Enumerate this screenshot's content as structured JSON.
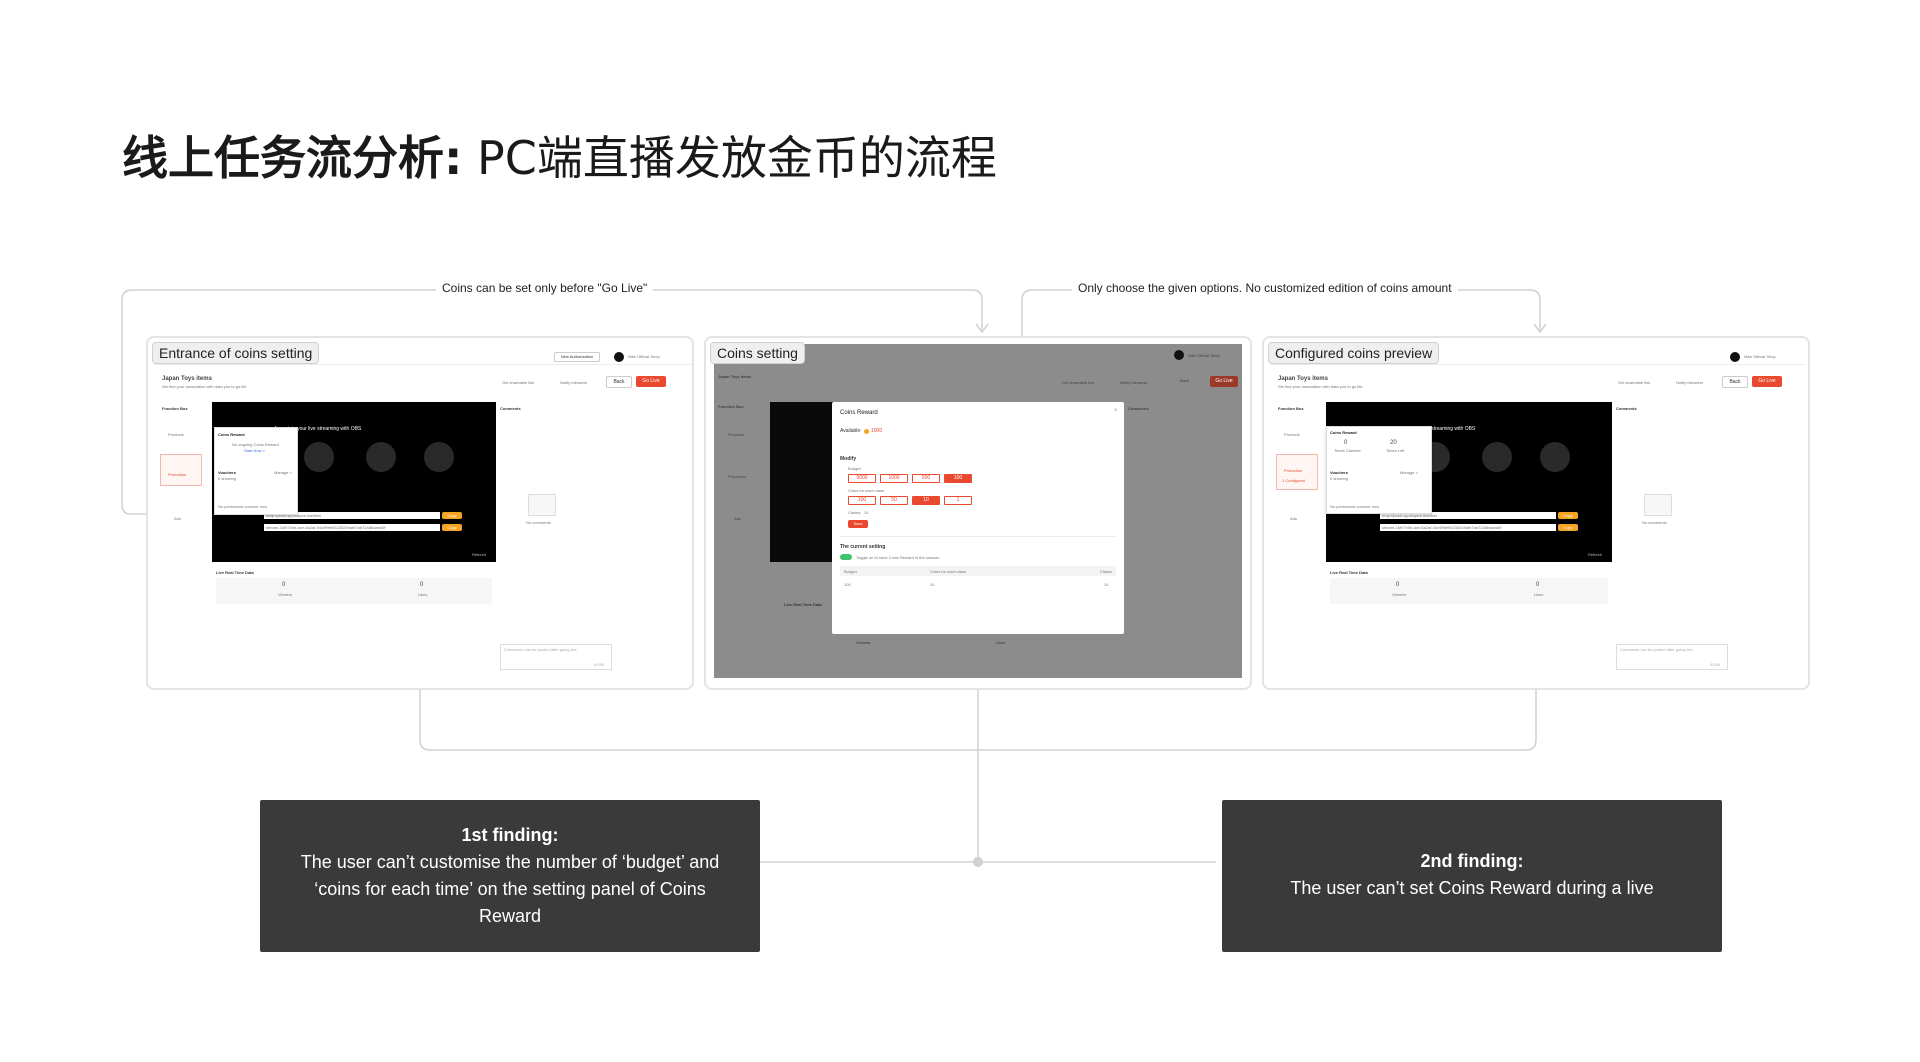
{
  "page": {
    "title_bold": "线上任务流分析:",
    "title_rest": " PC端直播发放金币的流程"
  },
  "annotations": {
    "left": "Coins can be set only before \"Go Live\"",
    "right": "Only choose the given options. No customized edition of coins amount"
  },
  "panels": [
    {
      "tag": "Entrance of coins setting"
    },
    {
      "tag": "Coins setting"
    },
    {
      "tag": "Configured coins preview"
    }
  ],
  "app": {
    "page_title": "Japan Toys items",
    "page_subtitle": "We find your association with data you to go life",
    "get_shareable_link": "Get shareable link",
    "notify_followers": "Notify followers",
    "back": "Back",
    "go_live": "Go Live",
    "new_authorization": "New Authorization",
    "shop_name": "Nike Official Shop",
    "function_box": "Function Box",
    "products": "Products",
    "promotion": "Promotion",
    "ads": "Ads",
    "comments": "Comments",
    "no_comments": "No comments",
    "obs_heading": "Associate your live streaming with OBS",
    "steps": [
      "1.Fill in the URL and Key in the OBS",
      "2.Click \"start streaming\" in the OBS",
      "3.Refresh to preview live stream"
    ],
    "stream_url": "rtmp://push-sg.shopee.live/live/",
    "stream_key": "stream-16f07e5e-ace-6a2af-04c9f9fe93235269afb7ab7248bdaea0f",
    "copy": "Copy",
    "refresh": "Refresh",
    "live_real_time_data": "Live Real Time Data",
    "viewers_value": "0",
    "viewers": "Viewers",
    "likes_value": "0",
    "likes": "Likes",
    "comment_placeholder": "Comments can be posted after going live",
    "comment_counter": "0/150",
    "coins_reward": "Coins Reward",
    "no_ongoing": "No ongoing Coins Reward",
    "start_now": "Start Now >",
    "vouchers": "Vouchers",
    "manage": "Manage >",
    "showing": "0 showing",
    "no_permanent": "No permanent voucher now",
    "times_claimed_value": "0",
    "times_claimed": "Times Claimed",
    "times_left_value": "20",
    "times_left": "Times Left",
    "configured": "1 Configured"
  },
  "modal": {
    "title": "Coins Reward",
    "available_label": "Available:",
    "available_value": "1000",
    "modify": "Modify",
    "budget": "Budget",
    "budget_options": [
      "5000",
      "1000",
      "500",
      "100"
    ],
    "coins_each": "Coins for each claim",
    "coins_options": [
      "100",
      "50",
      "10",
      "1"
    ],
    "claims_label": "Claims:",
    "claims_value": "10",
    "save": "Save",
    "current_setting": "The current setting",
    "toggle_text": "Toggle on to have Coins Reward in the session",
    "table_headers": [
      "Budget",
      "Coins for each claim",
      "Claims"
    ],
    "table_row": [
      "100",
      "10",
      "10"
    ]
  },
  "findings": [
    {
      "heading": "1st finding:",
      "body": "The user can’t customise the number of ‘budget’ and ‘coins for each time’ on the setting panel of Coins Reward"
    },
    {
      "heading": "2nd finding:",
      "body": "The user can’t set Coins Reward during a live"
    }
  ],
  "colors": {
    "accent": "#e8492f",
    "finding_bg": "#3a3a3a",
    "connector": "#cfcfcf"
  }
}
